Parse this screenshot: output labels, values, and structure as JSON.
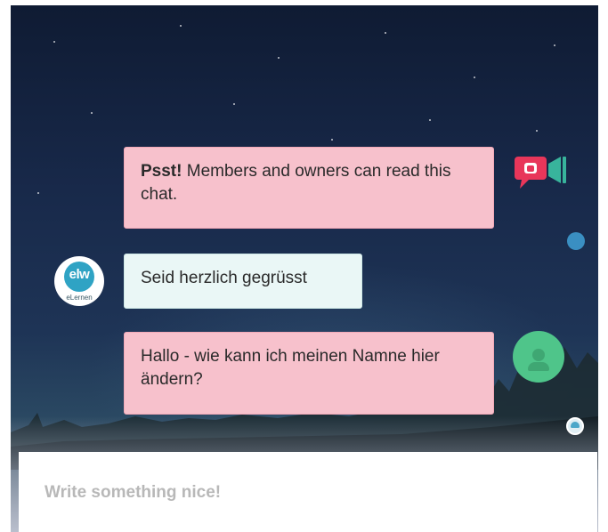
{
  "messages": [
    {
      "sender": "owner",
      "bold": "Psst!",
      "text": " Members and owners can read this chat."
    },
    {
      "sender": "visitor",
      "text": "Seid herzlich gegrüsst"
    },
    {
      "sender": "owner",
      "text": "Hallo - wie kann ich meinen Namne hier ändern?"
    }
  ],
  "logo": {
    "mark": "elw",
    "caption": "eLernen"
  },
  "composer": {
    "placeholder": "Write something nice!"
  },
  "icons": {
    "video_chat": "video-chat-icon",
    "presence": "status-dot-icon",
    "user_avatar": "user-avatar-icon"
  },
  "colors": {
    "owner_bubble": "#f7c1cc",
    "visitor_bubble": "#eaf7f6",
    "avatar_green": "#4fc58a",
    "logo_blue": "#2fa3c4",
    "icon_red": "#e8365a",
    "icon_teal": "#38b49c"
  }
}
